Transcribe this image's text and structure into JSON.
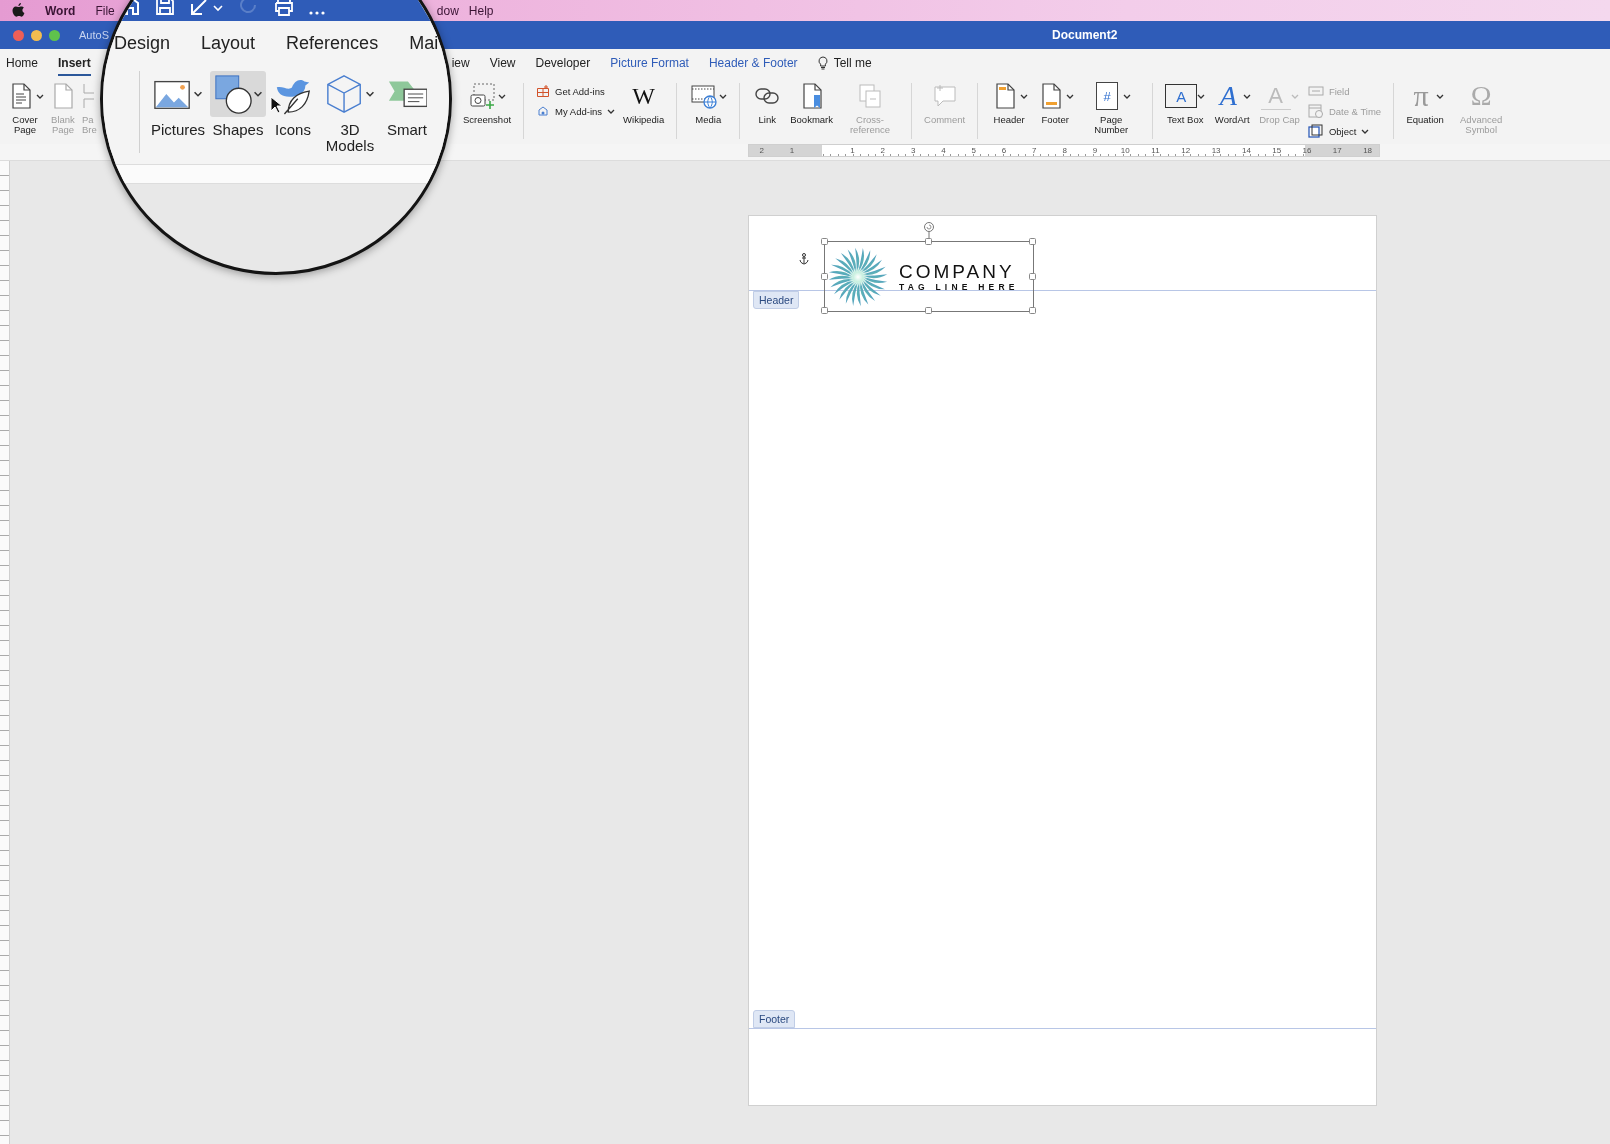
{
  "menu_bar": {
    "items": [
      {
        "label": "Word",
        "kind": "app"
      },
      {
        "label": "File",
        "kind": "menu"
      },
      {
        "label": "dow",
        "kind": "menu"
      },
      {
        "label": "Help",
        "kind": "menu"
      }
    ]
  },
  "title_bar": {
    "autosave": "AutoS",
    "title": "Document2"
  },
  "tabs": [
    {
      "label": "Home",
      "selected": false,
      "contextual": false
    },
    {
      "label": "Insert",
      "selected": true,
      "contextual": false
    },
    {
      "label": "iew",
      "selected": false,
      "contextual": false
    },
    {
      "label": "View",
      "selected": false,
      "contextual": false
    },
    {
      "label": "Developer",
      "selected": false,
      "contextual": false
    },
    {
      "label": "Picture Format",
      "selected": false,
      "contextual": true
    },
    {
      "label": "Header & Footer",
      "selected": false,
      "contextual": true
    }
  ],
  "tell_me": {
    "label": "Tell me"
  },
  "ribbon": {
    "groups": [
      {
        "buttons": [
          {
            "kind": "large",
            "label": "Cover Page",
            "disabled": false,
            "dropdown": true
          },
          {
            "kind": "large",
            "label": "Blank Page",
            "disabled": true,
            "dropdown": false
          },
          {
            "kind": "large",
            "label": "Pa Bre",
            "disabled": true,
            "dropdown": false
          }
        ]
      },
      {
        "buttons": [
          {
            "kind": "large",
            "label": "Screenshot",
            "disabled": false,
            "dropdown": true
          }
        ]
      },
      {
        "buttons": [
          {
            "kind": "small",
            "label": "Get Add-ins",
            "disabled": false,
            "dropdown": false
          },
          {
            "kind": "small",
            "label": "My Add-ins",
            "disabled": false,
            "dropdown": true
          },
          {
            "kind": "large",
            "label": "Wikipedia",
            "disabled": false,
            "dropdown": false,
            "glyph": "W"
          }
        ]
      },
      {
        "buttons": [
          {
            "kind": "large",
            "label": "Media",
            "disabled": false,
            "dropdown": true
          }
        ]
      },
      {
        "buttons": [
          {
            "kind": "large",
            "label": "Link",
            "disabled": false,
            "dropdown": false
          },
          {
            "kind": "large",
            "label": "Bookmark",
            "disabled": false,
            "dropdown": false
          },
          {
            "kind": "large",
            "label": "Cross-reference",
            "disabled": true,
            "dropdown": false
          }
        ]
      },
      {
        "buttons": [
          {
            "kind": "large",
            "label": "Comment",
            "disabled": true,
            "dropdown": false
          }
        ]
      },
      {
        "buttons": [
          {
            "kind": "large",
            "label": "Header",
            "disabled": false,
            "dropdown": true
          },
          {
            "kind": "large",
            "label": "Footer",
            "disabled": false,
            "dropdown": true
          },
          {
            "kind": "large",
            "label": "Page Number",
            "disabled": false,
            "dropdown": true,
            "glyph": "#"
          }
        ]
      },
      {
        "buttons": [
          {
            "kind": "large",
            "label": "Text Box",
            "disabled": false,
            "dropdown": true,
            "glyph": "A"
          },
          {
            "kind": "large",
            "label": "WordArt",
            "disabled": false,
            "dropdown": true,
            "glyph": "A"
          },
          {
            "kind": "large",
            "label": "Drop Cap",
            "disabled": true,
            "dropdown": true,
            "glyph": "A"
          },
          {
            "kind": "small",
            "label": "Field",
            "disabled": true,
            "dropdown": false
          },
          {
            "kind": "small",
            "label": "Date & Time",
            "disabled": true,
            "dropdown": false
          },
          {
            "kind": "small",
            "label": "Object",
            "disabled": false,
            "dropdown": true
          }
        ]
      },
      {
        "buttons": [
          {
            "kind": "large",
            "label": "Equation",
            "disabled": false,
            "dropdown": true,
            "glyph": "π"
          },
          {
            "kind": "large",
            "label": "Advanced Symbol",
            "disabled": true,
            "dropdown": false,
            "glyph": "Ω"
          }
        ]
      }
    ]
  },
  "ruler": {
    "marks": [
      "2",
      "1",
      "1",
      "2",
      "3",
      "4",
      "5",
      "6",
      "7",
      "8",
      "9",
      "10",
      "11",
      "12",
      "13",
      "14",
      "15",
      "16",
      "17",
      "18"
    ]
  },
  "document": {
    "header": {
      "label": "Header",
      "logo": {
        "name": "COMPANY",
        "tagline": "TAG LINE HERE",
        "selected": true
      }
    },
    "footer": {
      "label": "Footer"
    }
  },
  "magnifier": {
    "tabs": [
      "Design",
      "Layout",
      "References",
      "Mai"
    ],
    "buttons": [
      {
        "label": "Pictures",
        "dropdown": true,
        "highlighted": false
      },
      {
        "label": "Shapes",
        "dropdown": true,
        "highlighted": true
      },
      {
        "label": "Icons",
        "dropdown": false,
        "highlighted": false
      },
      {
        "label": "3D Models",
        "dropdown": true,
        "highlighted": false
      },
      {
        "label": "Smart",
        "dropdown": false,
        "highlighted": false
      }
    ]
  }
}
